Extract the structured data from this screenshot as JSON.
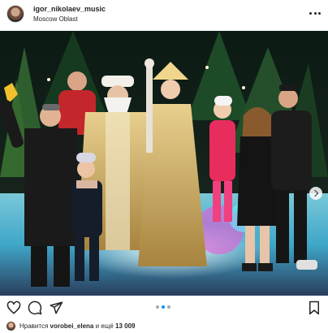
{
  "post": {
    "username": "igor_nikolaev_music",
    "location": "Moscow Oblast",
    "likes": {
      "prefix": "Нравится",
      "liker": "vorobei_elena",
      "middle": "и ещё",
      "count": "13 009"
    },
    "carousel": {
      "slides": 3,
      "current_slide": 2
    }
  },
  "icons": {
    "more": "more-horizontal-icon",
    "like": "heart-icon",
    "comment": "comment-icon",
    "share": "send-icon",
    "save": "bookmark-icon",
    "next": "chevron-right-icon"
  },
  "colors": {
    "text": "#262626",
    "accent": "#0095f6",
    "inactive_dot": "#a8a8a8"
  }
}
